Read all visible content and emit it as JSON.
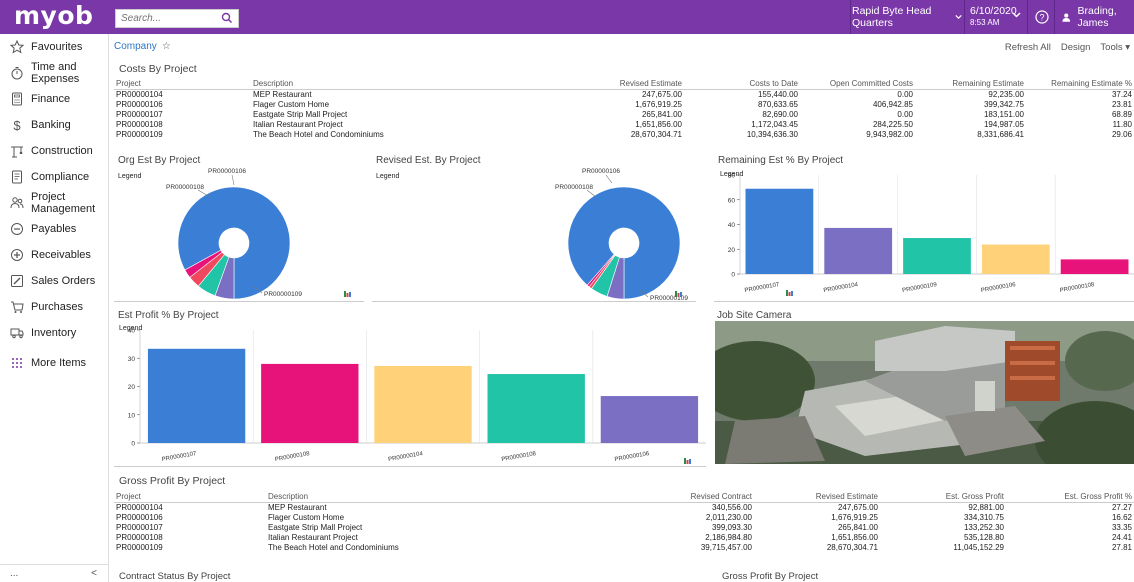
{
  "topbar": {
    "logo": "myob",
    "search_placeholder": "Search...",
    "company": "Rapid Byte Head Quarters",
    "date": "6/10/2020",
    "time": "8:53 AM",
    "user": "Brading, James"
  },
  "sidebar": {
    "items": [
      {
        "label": "Favourites",
        "icon": "star-icon"
      },
      {
        "label": "Time and Expenses",
        "icon": "stopwatch-icon"
      },
      {
        "label": "Finance",
        "icon": "calculator-icon"
      },
      {
        "label": "Banking",
        "icon": "dollar-icon"
      },
      {
        "label": "Construction",
        "icon": "crane-icon"
      },
      {
        "label": "Compliance",
        "icon": "document-icon"
      },
      {
        "label": "Project Management",
        "icon": "people-icon"
      },
      {
        "label": "Payables",
        "icon": "minus-circle-icon"
      },
      {
        "label": "Receivables",
        "icon": "plus-circle-icon"
      },
      {
        "label": "Sales Orders",
        "icon": "edit-icon"
      },
      {
        "label": "Purchases",
        "icon": "cart-icon"
      },
      {
        "label": "Inventory",
        "icon": "truck-icon"
      },
      {
        "label": "More Items",
        "icon": "grid-icon"
      }
    ],
    "bottom_dots": "...",
    "collapse": "<"
  },
  "breadcrumb": {
    "label": "Company",
    "star": "☆"
  },
  "toolbar": {
    "refresh": "Refresh All",
    "design": "Design",
    "tools": "Tools ▾"
  },
  "costs": {
    "title": "Costs By Project",
    "headers": [
      "Project",
      "Description",
      "Revised Estimate",
      "Costs to Date",
      "Open Committed Costs",
      "Remaining Estimate",
      "Remaining Estimate %"
    ],
    "rows": [
      [
        "PR00000104",
        "MEP Restaurant",
        "247,675.00",
        "155,440.00",
        "0.00",
        "92,235.00",
        "37.24"
      ],
      [
        "PR00000106",
        "Flager Custom Home",
        "1,676,919.25",
        "870,633.65",
        "406,942.85",
        "399,342.75",
        "23.81"
      ],
      [
        "PR00000107",
        "Eastgate Strip Mall Project",
        "265,841.00",
        "82,690.00",
        "0.00",
        "183,151.00",
        "68.89"
      ],
      [
        "PR00000108",
        "Italian Restaurant Project",
        "1,651,856.00",
        "1,172,043.45",
        "284,225.50",
        "194,987.05",
        "11.80"
      ],
      [
        "PR00000109",
        "The Beach Hotel and Condominiums",
        "28,670,304.71",
        "10,394,636.30",
        "9,943,982.00",
        "8,331,686.41",
        "29.06"
      ]
    ]
  },
  "panels": {
    "org_est": "Org Est By Project",
    "revised_est": "Revised Est. By Project",
    "remaining_pct": "Remaining Est % By Project",
    "est_profit": "Est Profit % By Project",
    "camera": "Job Site Camera",
    "legend": "Legend"
  },
  "pie_labels": {
    "top": "PR00000106",
    "left": "PR00000108",
    "bottom": "PR00000109"
  },
  "chart_data": [
    {
      "type": "pie",
      "title": "Org Est By Project",
      "categories": [
        "PR00000109",
        "PR00000108",
        "PR00000106",
        "PR00000107",
        "PR00000104"
      ],
      "values": [
        83.0,
        5.5,
        5.5,
        3.5,
        2.5
      ],
      "colors": [
        "#3a7fd5",
        "#7b6fc4",
        "#22c4a8",
        "#f0485f",
        "#e8137a"
      ]
    },
    {
      "type": "pie",
      "title": "Revised Est. By Project",
      "categories": [
        "PR00000109",
        "PR00000108",
        "PR00000106",
        "PR00000107",
        "PR00000104"
      ],
      "values": [
        87.0,
        4.8,
        4.9,
        0.8,
        0.7
      ],
      "colors": [
        "#3a7fd5",
        "#7b6fc4",
        "#22c4a8",
        "#f0485f",
        "#e8137a"
      ]
    },
    {
      "type": "bar",
      "title": "Remaining Est % By Project",
      "categories": [
        "PR00000107",
        "PR00000104",
        "PR00000109",
        "PR00000106",
        "PR00000108"
      ],
      "values": [
        68.89,
        37.24,
        29.06,
        23.81,
        11.8
      ],
      "colors": [
        "#3a7fd5",
        "#7b6fc4",
        "#22c4a8",
        "#ffd27a",
        "#e8137a"
      ],
      "ylim": [
        0,
        80
      ],
      "yticks": [
        0,
        20,
        40,
        60,
        80
      ]
    },
    {
      "type": "bar",
      "title": "Est Profit % By Project",
      "categories": [
        "PR00000107",
        "PR00000108",
        "PR00000104",
        "PR00000108",
        "PR00000106"
      ],
      "values": [
        33.35,
        28.0,
        27.27,
        24.41,
        16.62
      ],
      "colors": [
        "#3a7fd5",
        "#e8137a",
        "#ffd27a",
        "#22c4a8",
        "#7b6fc4"
      ],
      "ylim": [
        0,
        40
      ],
      "yticks": [
        0,
        10,
        20,
        30,
        40
      ]
    }
  ],
  "gross": {
    "title": "Gross Profit By Project",
    "headers": [
      "Project",
      "Description",
      "Revised Contract",
      "Revised Estimate",
      "Est. Gross Profit",
      "Est. Gross Profit %"
    ],
    "rows": [
      [
        "PR00000104",
        "MEP Restaurant",
        "340,556.00",
        "247,675.00",
        "92,881.00",
        "27.27"
      ],
      [
        "PR00000106",
        "Flager Custom Home",
        "2,011,230.00",
        "1,676,919.25",
        "334,310.75",
        "16.62"
      ],
      [
        "PR00000107",
        "Eastgate Strip Mall Project",
        "399,093.30",
        "265,841.00",
        "133,252.30",
        "33.35"
      ],
      [
        "PR00000108",
        "Italian Restaurant Project",
        "2,186,984.80",
        "1,651,856.00",
        "535,128.80",
        "24.41"
      ],
      [
        "PR00000109",
        "The Beach Hotel and Condominiums",
        "39,715,457.00",
        "28,670,304.71",
        "11,045,152.29",
        "27.81"
      ]
    ]
  },
  "bottom": {
    "contract_status": "Contract Status By Project",
    "gross_profit": "Gross Profit By Project"
  }
}
